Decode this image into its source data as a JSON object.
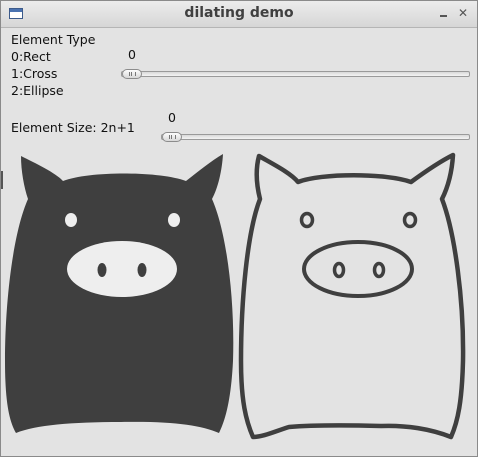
{
  "window": {
    "title": "dilating demo"
  },
  "controls": {
    "element_type": {
      "heading": "Element Type",
      "options": [
        "0:Rect",
        "1:Cross",
        "2:Ellipse"
      ],
      "value": "0",
      "slider_position": 0
    },
    "element_size": {
      "label": "Element Size: 2n+1",
      "value": "0",
      "slider_position": 0
    }
  },
  "images": [
    {
      "name": "dilated-result",
      "fill": "#3f3f3f",
      "style": "filled"
    },
    {
      "name": "original-outline",
      "fill": "#e3e3e3",
      "style": "outline",
      "stroke": "#3f3f3f"
    }
  ],
  "colors": {
    "window_bg": "#e3e3e3",
    "pig_dark": "#3f3f3f",
    "pig_light": "#e3e3e3"
  }
}
